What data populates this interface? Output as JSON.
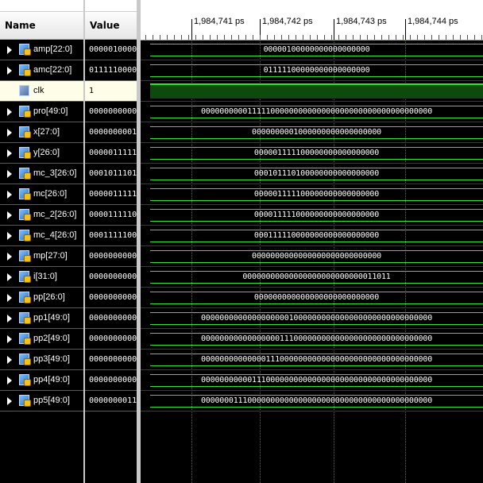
{
  "headers": {
    "name": "Name",
    "value": "Value"
  },
  "ruler": {
    "ticks": [
      "1,984,741 ps",
      "1,984,742 ps",
      "1,984,743 ps",
      "1,984,744 ps"
    ]
  },
  "signals": [
    {
      "name": "amp[22:0]",
      "value": "0000010000",
      "wave": "00000100000000000000000",
      "icon": "bus-signal-icon"
    },
    {
      "name": "amc[22:0]",
      "value": "0111110000",
      "wave": "01111100000000000000000",
      "icon": "bus-signal-icon"
    },
    {
      "name": "clk",
      "value": "1",
      "wave": "",
      "icon": "clock-signal-icon"
    },
    {
      "name": "pro[49:0]",
      "value": "0000000000",
      "wave": "00000000001111100000000000000000000000000000000000",
      "icon": "bus-signal-icon"
    },
    {
      "name": "x[27:0]",
      "value": "0000000001",
      "wave": "0000000001000000000000000000",
      "icon": "bus-signal-icon"
    },
    {
      "name": "y[26:0]",
      "value": "0000011111",
      "wave": "000001111100000000000000000",
      "icon": "bus-signal-icon"
    },
    {
      "name": "mc_3[26:0]",
      "value": "0001011101",
      "wave": "000101110100000000000000000",
      "icon": "bus-signal-icon"
    },
    {
      "name": "mc[26:0]",
      "value": "0000011111",
      "wave": "000001111100000000000000000",
      "icon": "bus-signal-icon"
    },
    {
      "name": "mc_2[26:0]",
      "value": "0000111110",
      "wave": "000011111000000000000000000",
      "icon": "bus-signal-icon"
    },
    {
      "name": "mc_4[26:0]",
      "value": "0001111100",
      "wave": "000111110000000000000000000",
      "icon": "bus-signal-icon"
    },
    {
      "name": "mp[27:0]",
      "value": "0000000000",
      "wave": "0000000000000000000000000000",
      "icon": "bus-signal-icon"
    },
    {
      "name": "i[31:0]",
      "value": "0000000000",
      "wave": "00000000000000000000000000011011",
      "icon": "bus-signal-icon"
    },
    {
      "name": "pp[26:0]",
      "value": "0000000000",
      "wave": "000000000000000000000000000",
      "icon": "bus-signal-icon"
    },
    {
      "name": "pp1[49:0]",
      "value": "0000000000",
      "wave": "00000000000000000001000000000000000000000000000000",
      "icon": "bus-signal-icon"
    },
    {
      "name": "pp2[49:0]",
      "value": "0000000000",
      "wave": "00000000000000000111000000000000000000000000000000",
      "icon": "bus-signal-icon"
    },
    {
      "name": "pp3[49:0]",
      "value": "0000000000",
      "wave": "00000000000000111000000000000000000000000000000000",
      "icon": "bus-signal-icon"
    },
    {
      "name": "pp4[49:0]",
      "value": "0000000000",
      "wave": "00000000000111000000000000000000000000000000000000",
      "icon": "bus-signal-icon"
    },
    {
      "name": "pp5[49:0]",
      "value": "0000000011",
      "wave": "00000001110000000000000000000000000000000000000000",
      "icon": "bus-signal-icon"
    }
  ],
  "colors": {
    "wave": "#37e237",
    "background": "#000000",
    "selected_row": "#fdfde8"
  }
}
